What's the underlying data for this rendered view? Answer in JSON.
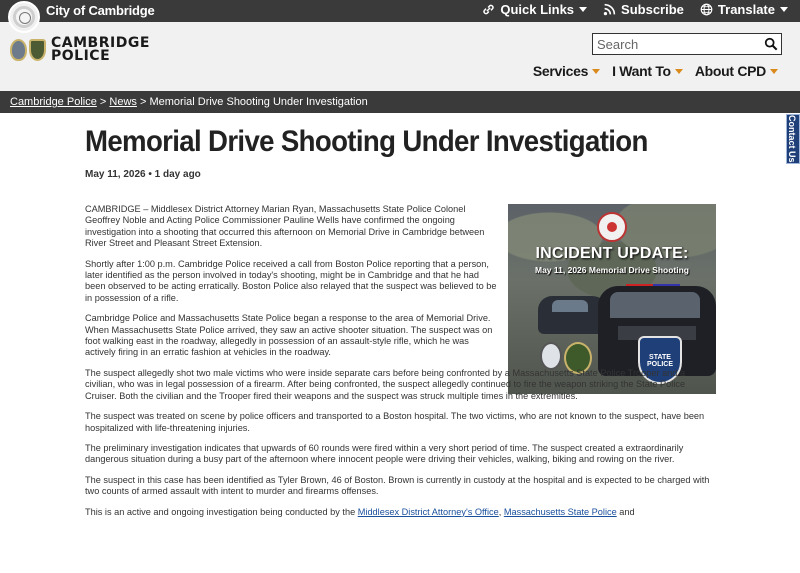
{
  "topbar": {
    "city_name": "City of Cambridge",
    "links": [
      {
        "label": "Quick Links",
        "icon": "link-icon"
      },
      {
        "label": "Subscribe",
        "icon": "rss-icon"
      },
      {
        "label": "Translate",
        "icon": "globe-icon"
      }
    ]
  },
  "header": {
    "logo_line1": "CAMBRIDGE",
    "logo_line2": "POLICE",
    "search_placeholder": "Search",
    "nav": [
      {
        "label": "Services"
      },
      {
        "label": "I Want To"
      },
      {
        "label": "About CPD"
      }
    ]
  },
  "breadcrumb": {
    "home": "Cambridge Police",
    "section": "News",
    "current": "Memorial Drive Shooting Under Investigation",
    "separator": ">"
  },
  "contact_tab": "Contact Us",
  "article": {
    "title": "Memorial Drive Shooting Under Investigation",
    "date": "May 11, 2026 • 1 day ago",
    "image": {
      "title": "INCIDENT UPDATE:",
      "subtitle": "May 11, 2026 Memorial Drive Shooting",
      "patch_text": "STATE POLICE"
    },
    "paragraphs": [
      "CAMBRIDGE – Middlesex District Attorney Marian Ryan, Massachusetts State Police Colonel Geoffrey Noble and Acting Police Commissioner Pauline Wells have confirmed the ongoing investigation into a shooting that occurred this afternoon on Memorial Drive in Cambridge between River Street and Pleasant Street Extension.",
      "Shortly after 1:00 p.m. Cambridge Police received a call from Boston Police reporting that a person, later identified as the person involved in today's shooting, might be in Cambridge and that he had been observed to be acting erratically. Boston Police also relayed that the suspect was believed to be in possession of a rifle.",
      "Cambridge Police and Massachusetts State Police began a response to the area of Memorial Drive. When Massachusetts State Police arrived, they saw an active shooter situation.  The suspect was on foot walking east in the roadway, allegedly in possession of an assault-style rifle, which he was actively firing in an erratic fashion at vehicles in the roadway.",
      "The suspect allegedly shot two male victims who were inside separate cars before being confronted by a Massachusetts State Police Trooper and a civilian, who was in legal possession of a firearm.  After being confronted, the suspect allegedly continued to fire the weapon striking the State Police Cruiser.  Both the civilian and the Trooper fired their weapons and the suspect was struck multiple times in the extremities.",
      "The suspect was treated on scene by police officers and transported to a Boston hospital. The two victims, who are not known to the suspect,  have been hospitalized with life-threatening injuries.",
      "The preliminary investigation indicates that upwards of 60 rounds were fired within a very short period of time. The suspect created a extraordinarily dangerous situation during a busy part of the afternoon where innocent people were driving their vehicles, walking, biking and rowing on the river.",
      "The suspect in this case has been identified as Tyler Brown, 46 of Boston. Brown is currently in custody at the hospital and is expected to be charged with two counts of armed assault with intent to murder and firearms offenses."
    ],
    "last_paragraph": {
      "prefix": "This is an active and ongoing investigation being conducted by the ",
      "link1": "Middlesex District Attorney's Office",
      "sep": ", ",
      "link2": "Massachusetts State Police",
      "suffix": " and"
    }
  },
  "colors": {
    "dark_bar": "#3a3a3a",
    "header_bg": "#f1f1f1",
    "nav_caret": "#d98a1a",
    "contact_tab": "#1f3f78",
    "link": "#1a4f9c"
  }
}
